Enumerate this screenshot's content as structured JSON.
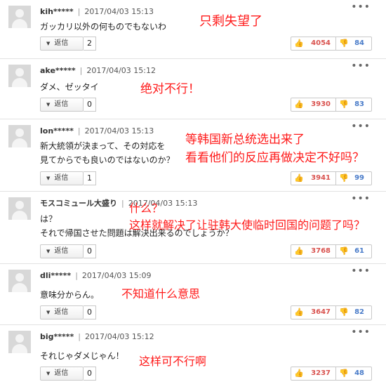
{
  "icons": {
    "reply_caret": "caret-down-icon",
    "more": "more-dots-icon",
    "up": "thumbs-up-icon",
    "down": "thumbs-down-icon"
  },
  "colors": {
    "annotation": "#ff1a1a",
    "upvote": "#d9534f",
    "downvote": "#4a7cc9"
  },
  "comments": [
    {
      "user": "kih*****",
      "sep": "|",
      "time": "2017/04/03 15:13",
      "more": "•••",
      "lines": [
        "ガッカリ以外の何ものでもないわ"
      ],
      "reply_label": "返信",
      "reply_count": "2",
      "up": "4054",
      "down": "84",
      "annotation": [
        "只剩失望了"
      ]
    },
    {
      "user": "ake*****",
      "sep": "|",
      "time": "2017/04/03 15:12",
      "more": "•••",
      "lines": [
        "ダメ、ゼッタイ"
      ],
      "reply_label": "返信",
      "reply_count": "0",
      "up": "3930",
      "down": "83",
      "annotation": [
        "绝对不行！"
      ]
    },
    {
      "user": "lon*****",
      "sep": "|",
      "time": "2017/04/03 15:13",
      "more": "•••",
      "lines": [
        "新大統領が決まって、その対応を",
        "見てからでも良いのではないのか？"
      ],
      "reply_label": "返信",
      "reply_count": "1",
      "up": "3941",
      "down": "99",
      "annotation": [
        "等韩国新总统选出来了",
        "看看他们的反应再做决定不好吗？"
      ]
    },
    {
      "user": "モスコミュール大盛り",
      "sep": "|",
      "time": "2017/04/03 15:13",
      "more": "•••",
      "lines": [
        "は？",
        "それで帰国させた問題は解決出来るのでしょうか？"
      ],
      "reply_label": "返信",
      "reply_count": "0",
      "up": "3768",
      "down": "61",
      "annotation": [
        "什么？",
        "这样就解决了让驻韩大使临时回国的问题了吗？"
      ]
    },
    {
      "user": "dli*****",
      "sep": "|",
      "time": "2017/04/03 15:09",
      "more": "•••",
      "lines": [
        "意味分からん。"
      ],
      "reply_label": "返信",
      "reply_count": "0",
      "up": "3647",
      "down": "82",
      "annotation": [
        "不知道什么意思"
      ]
    },
    {
      "user": "big*****",
      "sep": "|",
      "time": "2017/04/03 15:12",
      "more": "•••",
      "lines": [
        "それじゃダメじゃん！"
      ],
      "reply_label": "返信",
      "reply_count": "0",
      "up": "3237",
      "down": "48",
      "annotation": [
        "这样可不行啊"
      ]
    }
  ]
}
